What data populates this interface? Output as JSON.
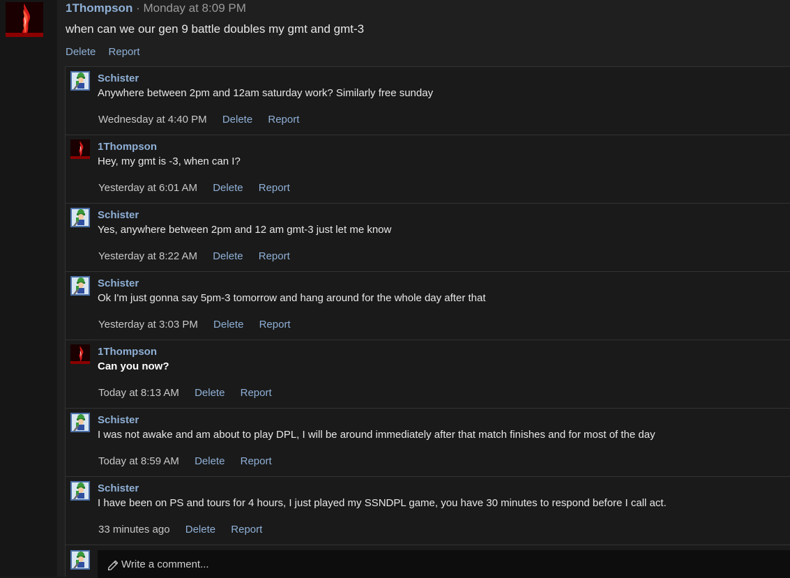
{
  "post": {
    "author": "1Thompson",
    "separator": " · ",
    "time": "Monday at 8:09 PM",
    "body": "when can we our gen 9 battle doubles my gmt and gmt-3",
    "actions": {
      "delete": "Delete",
      "report": "Report"
    }
  },
  "comments": [
    {
      "author": "Schister",
      "avatar": "schister",
      "text": "Anywhere between 2pm and 12am saturday work? Similarly free sunday",
      "bold": false,
      "time": "Wednesday at 4:40 PM",
      "delete": "Delete",
      "report": "Report"
    },
    {
      "author": "1Thompson",
      "avatar": "thompson",
      "text": "Hey, my gmt is -3, when can I?",
      "bold": false,
      "time": "Yesterday at 6:01 AM",
      "delete": "Delete",
      "report": "Report"
    },
    {
      "author": "Schister",
      "avatar": "schister",
      "text": "Yes, anywhere between 2pm and 12 am gmt-3 just let me know",
      "bold": false,
      "time": "Yesterday at 8:22 AM",
      "delete": "Delete",
      "report": "Report"
    },
    {
      "author": "Schister",
      "avatar": "schister",
      "text": "Ok I'm just gonna say 5pm-3 tomorrow and hang around for the whole day after that",
      "bold": false,
      "time": "Yesterday at 3:03 PM",
      "delete": "Delete",
      "report": "Report"
    },
    {
      "author": "1Thompson",
      "avatar": "thompson",
      "text": "Can you now?",
      "bold": true,
      "time": "Today at 8:13 AM",
      "delete": "Delete",
      "report": "Report"
    },
    {
      "author": "Schister",
      "avatar": "schister",
      "text": "I was not awake and am about to play DPL, I will be around immediately after that match finishes and for most of the day",
      "bold": false,
      "time": "Today at 8:59 AM",
      "delete": "Delete",
      "report": "Report"
    },
    {
      "author": "Schister",
      "avatar": "schister",
      "text": "I have been on PS and tours for 4 hours, I just played my SSNDPL game, you have 30 minutes to respond before I call act.",
      "bold": false,
      "time": "33 minutes ago",
      "delete": "Delete",
      "report": "Report"
    }
  ],
  "compose": {
    "placeholder": "Write a comment...",
    "icon": "pencil-icon"
  },
  "colors": {
    "link": "#8fb0d6",
    "background": "#1a1a1a"
  }
}
